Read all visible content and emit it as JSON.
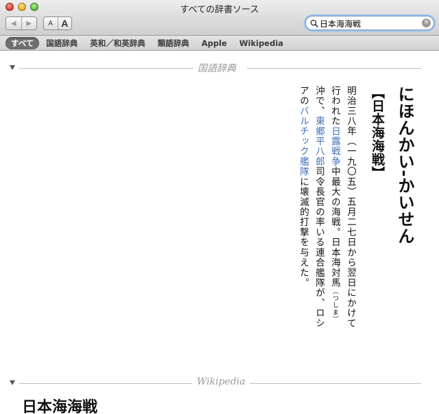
{
  "window": {
    "title": "すべての辞書ソース"
  },
  "toolbar": {
    "back_glyph": "◀",
    "forward_glyph": "▶",
    "font_smaller_label": "A",
    "font_larger_label": "A"
  },
  "search": {
    "value": "日本海海戦"
  },
  "scope_tabs": [
    "すべて",
    "国語辞典",
    "英和／和英辞典",
    "類語辞典",
    "Apple",
    "Wikipedia"
  ],
  "sections": {
    "kokugo": {
      "title": "国語辞典",
      "headword": "にほんかい-かいせん",
      "kanji_form": "【日本海海戦】",
      "body": {
        "t1": "明治三八年（一九〇五）五月二七日から翌日にかけて行われた",
        "link1": "日露戦争",
        "t2": "中最大の海戦。日本海対馬",
        "ruby": "（つしま）",
        "t3": "沖で、",
        "link2": "東郷平八郎",
        "t4": "司令長官の率いる連合艦隊が、ロシアの",
        "link3": "バルチック艦隊",
        "t5": "に壊滅的打撃を与えた。"
      }
    },
    "wikipedia": {
      "title": "Wikipedia",
      "heading": "日本海海戦"
    }
  },
  "colors": {
    "link": "#3e6fb6",
    "active_scope": "#6f6f6f",
    "search_focus": "#9cc0ec"
  }
}
